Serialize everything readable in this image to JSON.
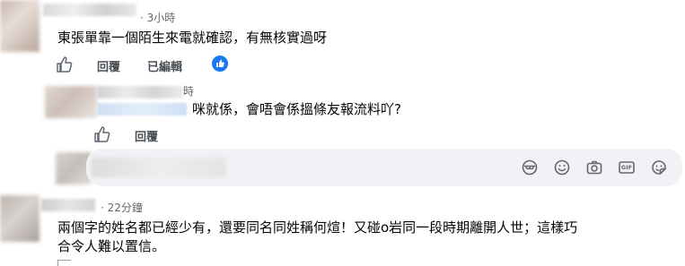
{
  "comments": [
    {
      "meta": "· 3小時",
      "text": "東張單靠一個陌生來電就確認，有無核實過呀",
      "actions": {
        "reply": "回覆",
        "edited": "已編輯"
      },
      "reaction": "like"
    },
    {
      "meta_partial": "時",
      "text": "咪就係，會唔會係搵條友報流料吖?",
      "actions": {
        "reply": "回覆"
      }
    },
    {
      "meta": "· 22分鐘",
      "text_lines": [
        "兩個字的姓名都已經少有，還要同名同姓稱何煊！又碰o岩同一段時期離開人世；這樣巧",
        "合令人難以置信。"
      ]
    }
  ],
  "composer": {
    "icons": [
      "avatar-frame-icon",
      "emoji-icon",
      "camera-icon",
      "gif-icon",
      "sticker-icon"
    ],
    "gif_label": "GIF"
  },
  "colors": {
    "accent": "#1877f2",
    "bubble": "#f0f2f5",
    "meta": "#65676b",
    "action": "#4b4f56"
  }
}
